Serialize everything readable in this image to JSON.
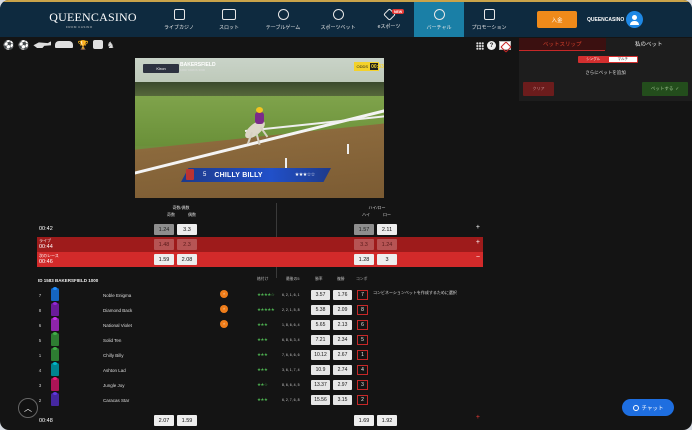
{
  "brand": {
    "name": "QUEENCASINO",
    "tagline": "FROM CASINO"
  },
  "nav": [
    {
      "label": "ライブカジノ",
      "icon": "live-casino-icon"
    },
    {
      "label": "スロット",
      "icon": "slot-icon"
    },
    {
      "label": "テーブルゲーム",
      "icon": "table-games-icon"
    },
    {
      "label": "スポーツベット",
      "icon": "sports-bet-icon"
    },
    {
      "label": "eスポーツ",
      "icon": "esports-icon",
      "badge": "NEW"
    },
    {
      "label": "バーチャル",
      "icon": "virtual-icon",
      "active": true
    },
    {
      "label": "プロモーション",
      "icon": "promotion-icon"
    }
  ],
  "header": {
    "deposit_label": "入金",
    "username": "QUEENCASINO"
  },
  "video": {
    "provider": "Kiron",
    "track": "BAKERSFIELD",
    "track_sub": "1000 YARDS   3000",
    "timer_label": "ODDS",
    "timer": "00:33",
    "runner_number": "5",
    "runner_name": "CHILLY BILLY",
    "runner_stars": "★★★☆☆"
  },
  "betslip": {
    "tabs": [
      "ベットスリップ",
      "私のベット"
    ],
    "modes": [
      "シングル",
      "マルチ"
    ],
    "hint": "さらにベットを追加",
    "clear_label": "クリア",
    "place_label": "ベットする"
  },
  "markets": {
    "left_title": "奇数/偶数",
    "left_cols": [
      "奇数",
      "偶数"
    ],
    "right_title": "ハイ/ロー",
    "right_cols": [
      "ハイ",
      "ロー"
    ],
    "rows": [
      {
        "time": "00:42",
        "status": "",
        "left": [
          "1.24",
          "3.3"
        ],
        "right": [
          "1.57",
          "2.11"
        ],
        "action": "+"
      },
      {
        "time": "00:44",
        "status": "ライブ",
        "left": [
          "1.48",
          "2.3"
        ],
        "right": [
          "3.3",
          "1.24"
        ],
        "action": "+"
      },
      {
        "time": "00:46",
        "status": "次のレース",
        "left": [
          "1.59",
          "2.08"
        ],
        "right": [
          "1.28",
          "3"
        ],
        "action": "−"
      }
    ]
  },
  "race": {
    "title": "ID 1583 BAKERSFIELD 1000",
    "columns": [
      "格付け",
      "最後の5",
      "勝率",
      "複勝",
      "コンボ"
    ],
    "combo_hint": "コンビネーションベットを作成するために選択",
    "runners": [
      {
        "num": "7",
        "name": "Noble Enigma",
        "badge": "⚡",
        "stars": "★★★★☆",
        "form": "6, 2, 1, 6, 1",
        "win": "3.57",
        "place": "1.76",
        "combo": "7",
        "silk": "#1565c0"
      },
      {
        "num": "8",
        "name": "Diamond Back",
        "badge": "⚡",
        "stars": "★★★★★",
        "form": "2, 2, 1, 5, 8",
        "win": "5.38",
        "place": "2.09",
        "combo": "8",
        "silk": "#6a1b9a"
      },
      {
        "num": "6",
        "name": "National Violet",
        "badge": "⚡",
        "stars": "★★★",
        "form": "1, 8, 6, 6, 4",
        "win": "5.65",
        "place": "2.13",
        "combo": "6",
        "silk": "#8e24aa"
      },
      {
        "num": "5",
        "name": "Solid Ten",
        "badge": "",
        "stars": "★★★",
        "form": "6, 8, 6, 3, 4",
        "win": "7.21",
        "place": "2.34",
        "combo": "5",
        "silk": "#2e7d32"
      },
      {
        "num": "1",
        "name": "Chilly Billy",
        "badge": "",
        "stars": "★★★",
        "form": "7, 6, 6, 6, 6",
        "win": "10.12",
        "place": "2.67",
        "combo": "1",
        "silk": "#2e7d32"
      },
      {
        "num": "4",
        "name": "Ashton Lad",
        "badge": "",
        "stars": "★★★",
        "form": "3, 6, 1, 7, 4",
        "win": "10.9",
        "place": "2.74",
        "combo": "4",
        "silk": "#00838f"
      },
      {
        "num": "3",
        "name": "Jungle Joy",
        "badge": "",
        "stars": "★★☆",
        "form": "8, 6, 6, 4, 5",
        "win": "13.37",
        "place": "2.97",
        "combo": "3",
        "silk": "#ad1457"
      },
      {
        "num": "2",
        "name": "Caracas Star",
        "badge": "",
        "stars": "★★★",
        "form": "6, 2, 7, 6, 8",
        "win": "15.56",
        "place": "3.15",
        "combo": "2",
        "silk": "#4527a0"
      }
    ]
  },
  "bottom_row": {
    "time": "00:48",
    "left": [
      "2.07",
      "1.59"
    ],
    "right": [
      "1.69",
      "1.92"
    ],
    "action": "+"
  },
  "chat": {
    "label": "チャット"
  },
  "colors": {
    "topbar": "#0e2a3f",
    "active_nav": "#1a7fa6",
    "live_row": "#9e1b1b",
    "next_row": "#d22a2a",
    "deposit": "#ef8a1a",
    "chat": "#1e6ee0"
  }
}
